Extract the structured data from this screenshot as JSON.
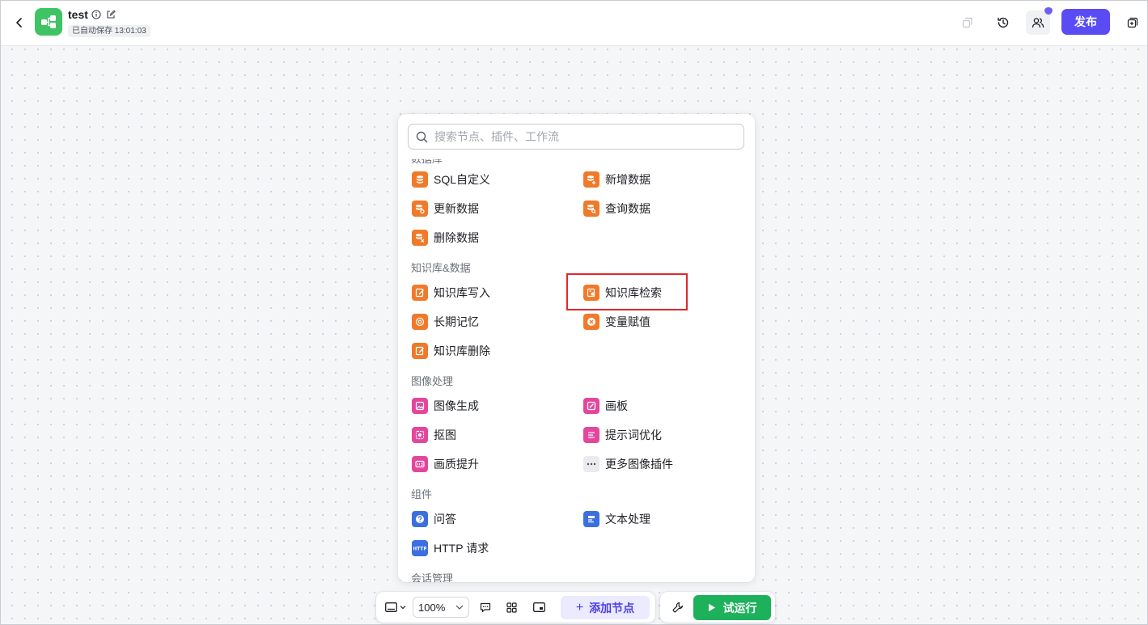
{
  "header": {
    "title": "test",
    "autosave": "已自动保存 13:01:03",
    "publish_label": "发布"
  },
  "panel": {
    "search_placeholder": "搜索节点、插件、工作流",
    "cut_top_label": "数据库",
    "sections": {
      "db_items": [
        "SQL自定义",
        "新增数据",
        "更新数据",
        "查询数据",
        "删除数据"
      ],
      "kb": {
        "title": "知识库&数据",
        "items": [
          "知识库写入",
          "知识库检索",
          "长期记忆",
          "变量赋值",
          "知识库删除"
        ]
      },
      "image": {
        "title": "图像处理",
        "items": [
          "图像生成",
          "画板",
          "抠图",
          "提示词优化",
          "画质提升",
          "更多图像插件"
        ]
      },
      "components": {
        "title": "组件",
        "items": [
          "问答",
          "文本处理",
          "HTTP 请求"
        ]
      },
      "cut_bottom_title": "会话管理"
    }
  },
  "toolbar": {
    "zoom": "100%",
    "add_node_label": "添加节点",
    "run_label": "试运行"
  },
  "colors": {
    "publish": "#5a4cf4",
    "run": "#1db15b",
    "orange_icon": "#f07a2a",
    "pink_icon": "#e4469c",
    "blue_icon": "#3b6fe0",
    "highlight": "#e2262b"
  }
}
